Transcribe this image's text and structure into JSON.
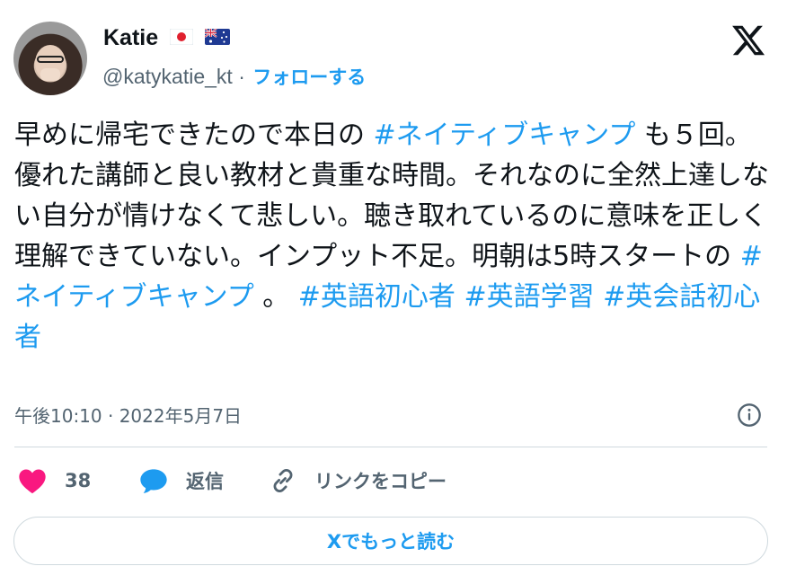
{
  "author": {
    "name": "Katie",
    "flags": [
      "japan-flag-icon",
      "australia-flag-icon"
    ],
    "handle": "@katykatie_kt",
    "separator": "·",
    "follow_label": "フォローする"
  },
  "tweet": {
    "segments": [
      {
        "text": "早めに帰宅できたので本日の ",
        "type": "text"
      },
      {
        "text": "#ネイティブキャンプ",
        "type": "hashtag"
      },
      {
        "text": " も５回。優れた講師と良い教材と貴重な時間。それなのに全然上達しない自分が情けなくて悲しい。聴き取れているのに意味を正しく理解できていない。インプット不足。明朝は5時スタートの ",
        "type": "text"
      },
      {
        "text": "#ネイティブキャンプ",
        "type": "hashtag"
      },
      {
        "text": " 。 ",
        "type": "text"
      },
      {
        "text": "#英語初心者",
        "type": "hashtag"
      },
      {
        "text": " ",
        "type": "text"
      },
      {
        "text": "#英語学習",
        "type": "hashtag"
      },
      {
        "text": " ",
        "type": "text"
      },
      {
        "text": "#英会話初心者",
        "type": "hashtag"
      }
    ],
    "timestamp": "午後10:10 · 2022年5月7日"
  },
  "actions": {
    "like_count": "38",
    "reply_label": "返信",
    "copy_link_label": "リンクをコピー"
  },
  "read_more_label": "Xでもっと読む",
  "colors": {
    "accent": "#1d9bf0",
    "like": "#f91880",
    "text": "#0f1419",
    "secondary": "#536471",
    "border": "#cfd9de"
  },
  "icons": [
    "x-logo-icon",
    "info-icon",
    "heart-icon",
    "reply-bubble-icon",
    "link-icon"
  ]
}
